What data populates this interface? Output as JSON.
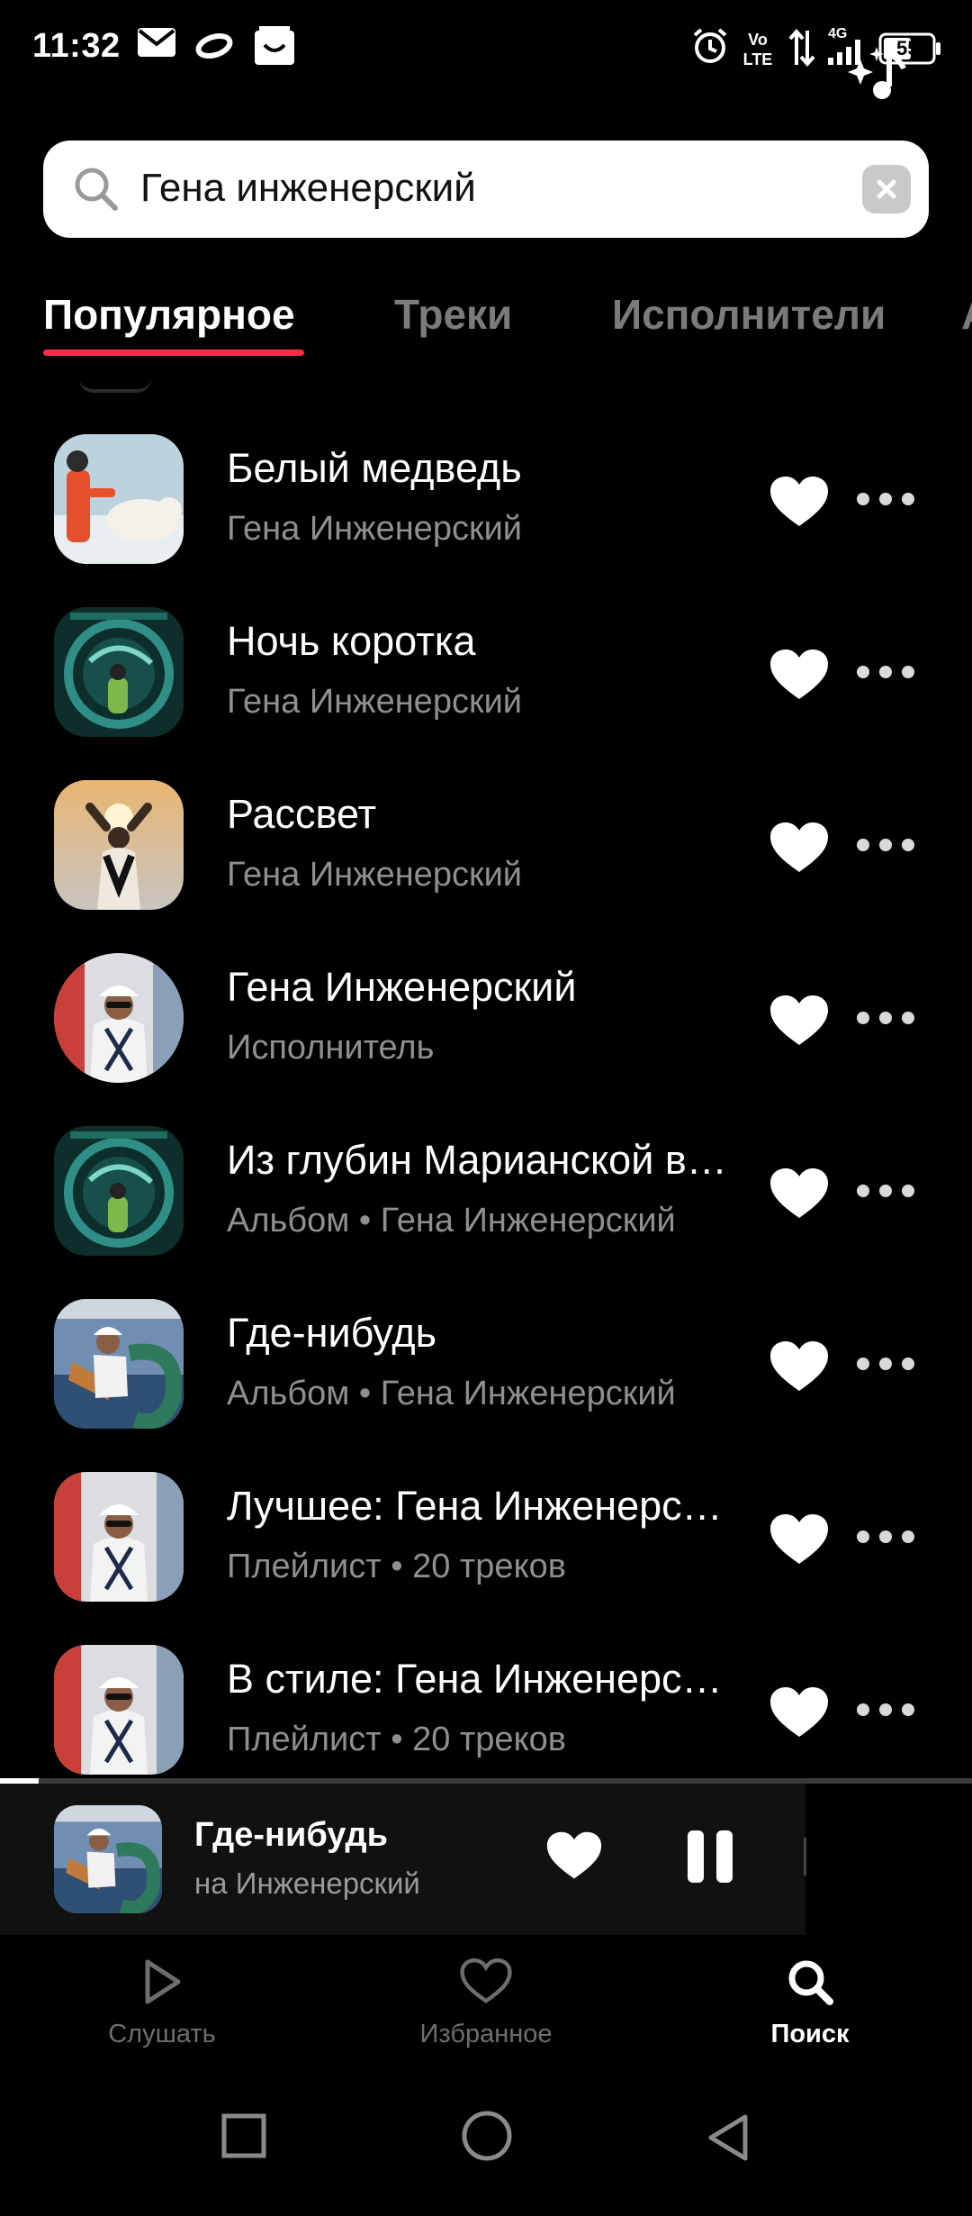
{
  "status_bar": {
    "time": "11:32",
    "battery": "55",
    "network": "4G",
    "volte": "Vo LTE",
    "icons": [
      "mail-icon",
      "oval-app-icon",
      "smile-app-icon",
      "alarm-icon",
      "volte-icon",
      "data-arrows-icon",
      "signal-icon",
      "battery-icon"
    ]
  },
  "search": {
    "query": "Гена инженерский",
    "icon": "search-icon",
    "clear_icon": "close-icon"
  },
  "tabs": [
    {
      "label": "Популярное",
      "active": true
    },
    {
      "label": "Треки",
      "active": false
    },
    {
      "label": "Исполнители",
      "active": false
    },
    {
      "label": "А",
      "active": false
    }
  ],
  "results": [
    {
      "title": "Белый медведь",
      "subtitle": "Гена Инженерский",
      "art": "polar-bear-cover"
    },
    {
      "title": "Ночь коротка",
      "subtitle": "Гена Инженерский",
      "art": "marianas-cover"
    },
    {
      "title": "Рассвет",
      "subtitle": "Гена Инженерский",
      "art": "sunrise-cover"
    },
    {
      "title": "Гена Инженерский",
      "subtitle": "Исполнитель",
      "art": "artist-photo"
    },
    {
      "title": "Из глубин Марианской впадины",
      "subtitle": "Альбом • Гена Инженерский",
      "art": "marianas-cover"
    },
    {
      "title": "Где-нибудь",
      "subtitle": "Альбом • Гена Инженерский",
      "art": "guitar-cover"
    },
    {
      "title": "Лучшее: Гена Инженерский",
      "subtitle": "Плейлист • 20 треков",
      "art": "artist-photo"
    },
    {
      "title": "В стиле: Гена Инженерский",
      "subtitle": "Плейлист • 20 треков",
      "art": "artist-photo"
    }
  ],
  "now_playing": {
    "title": "Где-нибудь",
    "artist": "на Инженерский",
    "progress": 0.04,
    "liked": true,
    "state": "playing"
  },
  "bottom_nav": [
    {
      "label": "Слушать",
      "icon": "play-icon",
      "active": false
    },
    {
      "label": "Избранное",
      "icon": "heart-outline-icon",
      "active": false
    },
    {
      "label": "Поиск",
      "icon": "search-icon",
      "active": true
    }
  ],
  "colors": {
    "accent": "#ff2d45",
    "background": "#000000",
    "muted_text": "#8f8f8f",
    "mini_player_bg": "#111111"
  }
}
